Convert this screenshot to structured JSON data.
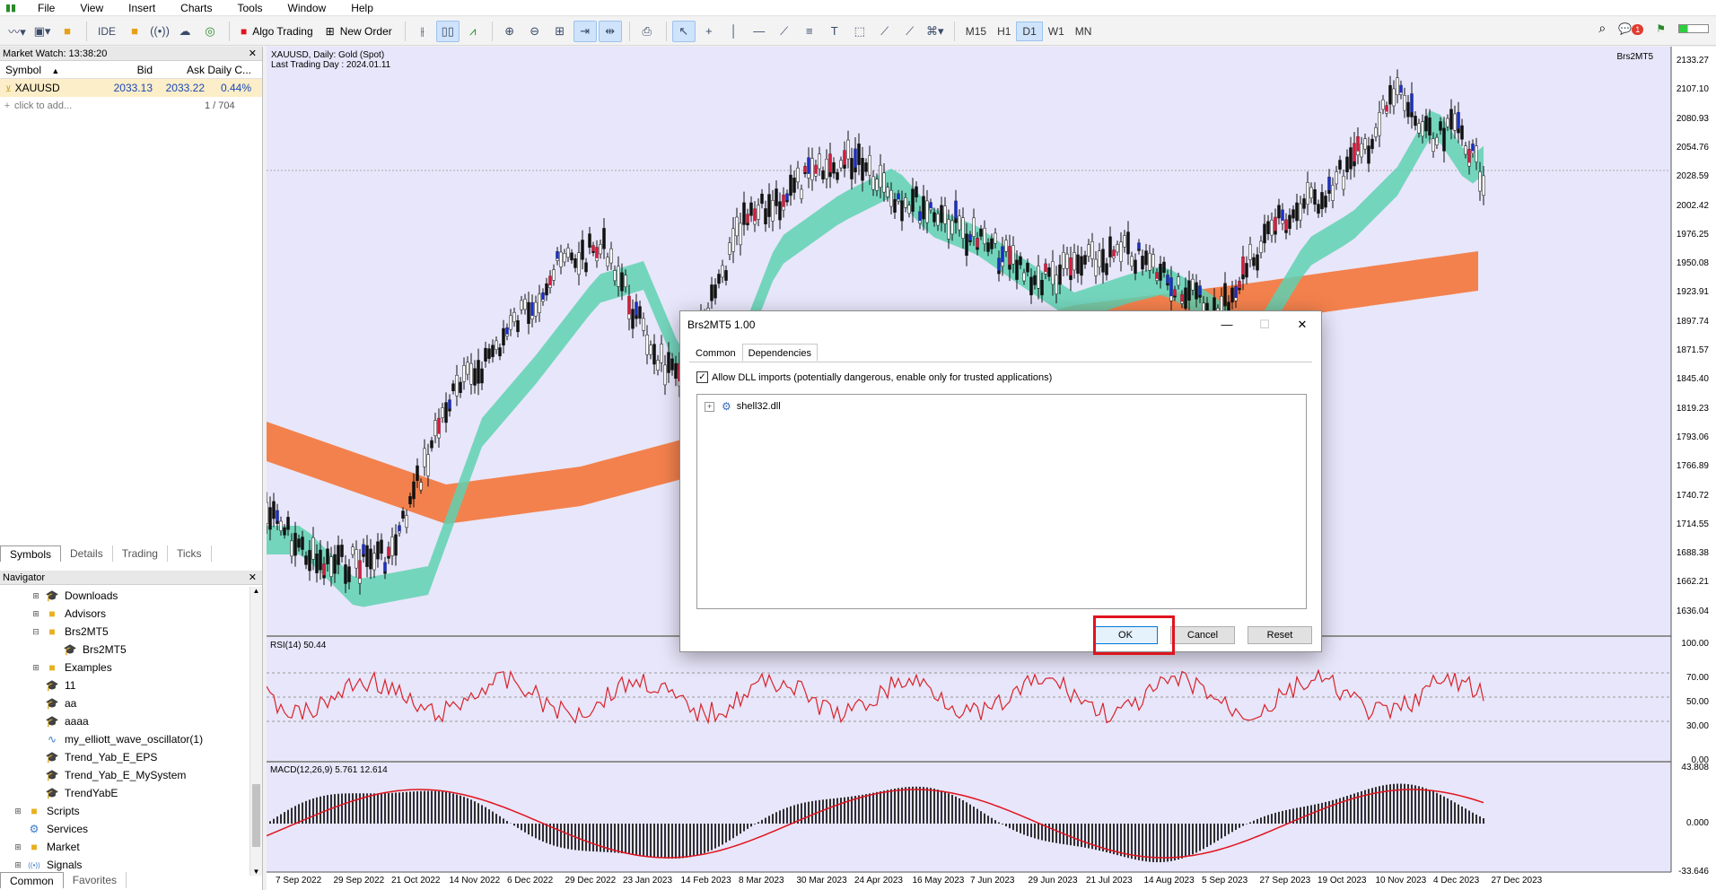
{
  "menu": [
    "File",
    "View",
    "Insert",
    "Charts",
    "Tools",
    "Window",
    "Help"
  ],
  "toolbar": {
    "ide": "IDE",
    "algo_trading": "Algo Trading",
    "new_order": "New Order",
    "timeframes": [
      "M15",
      "H1",
      "D1",
      "W1",
      "MN"
    ],
    "active_timeframe": "D1",
    "notification_count": "1"
  },
  "market_watch": {
    "title": "Market Watch: 13:38:20",
    "columns": [
      "Symbol",
      "Bid",
      "Ask",
      "Daily C..."
    ],
    "rows": [
      {
        "symbol": "XAUUSD",
        "bid": "2033.13",
        "ask": "2033.22",
        "daily": "0.44%"
      }
    ],
    "add_text": "click to add...",
    "count": "1 / 704",
    "tabs": [
      "Symbols",
      "Details",
      "Trading",
      "Ticks"
    ]
  },
  "navigator": {
    "title": "Navigator",
    "items": [
      {
        "label": "Downloads",
        "level": 1,
        "icon": "cap",
        "exp": "+"
      },
      {
        "label": "Advisors",
        "level": 1,
        "icon": "folder",
        "exp": "+"
      },
      {
        "label": "Brs2MT5",
        "level": 1,
        "icon": "folder",
        "exp": "−"
      },
      {
        "label": "Brs2MT5",
        "level": 2,
        "icon": "cap",
        "exp": ""
      },
      {
        "label": "Examples",
        "level": 1,
        "icon": "folder",
        "exp": "+"
      },
      {
        "label": "11",
        "level": 1,
        "icon": "cap",
        "exp": ""
      },
      {
        "label": "aa",
        "level": 1,
        "icon": "cap",
        "exp": ""
      },
      {
        "label": "aaaa",
        "level": 1,
        "icon": "cap",
        "exp": ""
      },
      {
        "label": "my_elliott_wave_oscillator(1)",
        "level": 1,
        "icon": "indicator",
        "exp": ""
      },
      {
        "label": "Trend_Yab_E_EPS",
        "level": 1,
        "icon": "cap",
        "exp": ""
      },
      {
        "label": "Trend_Yab_E_MySystem",
        "level": 1,
        "icon": "cap",
        "exp": ""
      },
      {
        "label": "TrendYabE",
        "level": 1,
        "icon": "cap",
        "exp": ""
      },
      {
        "label": "Scripts",
        "level": 0,
        "icon": "folder",
        "exp": "+"
      },
      {
        "label": "Services",
        "level": 0,
        "icon": "gear",
        "exp": ""
      },
      {
        "label": "Market",
        "level": 0,
        "icon": "folder",
        "exp": "+"
      },
      {
        "label": "Signals",
        "level": 0,
        "icon": "signal",
        "exp": "+"
      }
    ],
    "tabs": [
      "Common",
      "Favorites"
    ]
  },
  "chart": {
    "title_line1": "XAUUSD, Daily:  Gold (Spot)",
    "title_line2": "Last Trading Day : 2024.01.11",
    "indicator_tag": "Brs2MT5",
    "price_labels": [
      "2133.27",
      "2107.10",
      "2080.93",
      "2054.76",
      "2028.59",
      "2002.42",
      "1976.25",
      "1950.08",
      "1923.91",
      "1897.74",
      "1871.57",
      "1845.40",
      "1819.23",
      "1793.06",
      "1766.89",
      "1740.72",
      "1714.55",
      "1688.38",
      "1662.21",
      "1636.04"
    ],
    "rsi_title": "RSI(14) 50.44",
    "rsi_labels": [
      "100.00",
      "70.00",
      "50.00",
      "30.00",
      "0.00"
    ],
    "macd_title": "MACD(12,26,9) 5.761 12.614",
    "macd_labels": [
      "43.808",
      "0.000",
      "-33.646"
    ],
    "time_labels": [
      "7 Sep 2022",
      "29 Sep 2022",
      "21 Oct 2022",
      "14 Nov 2022",
      "6 Dec 2022",
      "29 Dec 2022",
      "23 Jan 2023",
      "14 Feb 2023",
      "8 Mar 2023",
      "30 Mar 2023",
      "24 Apr 2023",
      "16 May 2023",
      "7 Jun 2023",
      "29 Jun 2023",
      "21 Jul 2023",
      "14 Aug 2023",
      "5 Sep 2023",
      "27 Sep 2023",
      "19 Oct 2023",
      "10 Nov 2023",
      "4 Dec 2023",
      "27 Dec 2023"
    ]
  },
  "dialog": {
    "title": "Brs2MT5 1.00",
    "tabs": [
      "Common",
      "Dependencies"
    ],
    "active_tab": "Dependencies",
    "allow_dll_label": "Allow DLL imports (potentially dangerous, enable only for trusted applications)",
    "allow_dll_checked": true,
    "dependencies": [
      "shell32.dll"
    ],
    "buttons": {
      "ok": "OK",
      "cancel": "Cancel",
      "reset": "Reset"
    }
  },
  "colors": {
    "chart_bg": "#e8e6fa",
    "teal_band": "#5fd1b2",
    "orange_band": "#f4763a",
    "rsi_line": "#d8232a",
    "macd_hist": "#000000",
    "macd_signal": "#e0141e",
    "highlight": "#e0141e"
  }
}
